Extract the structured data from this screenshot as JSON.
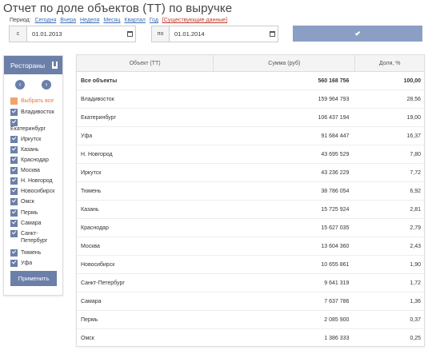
{
  "title": "Отчет по доле объектов (ТТ) по выручке",
  "period": {
    "label": "Период:",
    "links": [
      "Сегодня",
      "Вчера",
      "Неделя",
      "Месяц",
      "Квартал",
      "Год"
    ],
    "existing": "[Существующие данные]"
  },
  "date_from": {
    "prefix": "с",
    "value": "01.01.2013"
  },
  "date_to": {
    "prefix": "по",
    "value": "01.01.2014"
  },
  "sidebar": {
    "title": "Рестораны",
    "select_all": "Выбрать все",
    "items": [
      "Владивосток",
      "Екатеринбург",
      "Иркутск",
      "Казань",
      "Краснодар",
      "Москва",
      "Н. Новгород",
      "Новосибирск",
      "Омск",
      "Пермь",
      "Самара",
      "Санкт-Петербург",
      "Тюмень",
      "Уфа"
    ],
    "apply": "Применить"
  },
  "table": {
    "headers": [
      "Объект (ТТ)",
      "Сумма (руб)",
      "Доля, %"
    ],
    "total": {
      "name": "Все объекты",
      "sum": "560 168 756",
      "share": "100,00"
    },
    "rows": [
      {
        "name": "Владивосток",
        "sum": "159 964 793",
        "share": "28,56"
      },
      {
        "name": "Екатеринбург",
        "sum": "106 437 194",
        "share": "19,00"
      },
      {
        "name": "Уфа",
        "sum": "91 684 447",
        "share": "16,37"
      },
      {
        "name": "Н. Новгород",
        "sum": "43 695 529",
        "share": "7,80"
      },
      {
        "name": "Иркутск",
        "sum": "43 236 229",
        "share": "7,72"
      },
      {
        "name": "Тюмень",
        "sum": "38 786 054",
        "share": "6,92"
      },
      {
        "name": "Казань",
        "sum": "15 725 924",
        "share": "2,81"
      },
      {
        "name": "Краснодар",
        "sum": "15 627 035",
        "share": "2,79"
      },
      {
        "name": "Москва",
        "sum": "13 604 360",
        "share": "2,43"
      },
      {
        "name": "Новосибирск",
        "sum": "10 655 861",
        "share": "1,90"
      },
      {
        "name": "Санкт-Петербург",
        "sum": "9 641 319",
        "share": "1,72"
      },
      {
        "name": "Самара",
        "sum": "7 637 786",
        "share": "1,36"
      },
      {
        "name": "Пермь",
        "sum": "2 085 900",
        "share": "0,37"
      },
      {
        "name": "Омск",
        "sum": "1 386 333",
        "share": "0,25"
      }
    ]
  },
  "colors": {
    "accent": "#6b7fa9",
    "apply_top": "#8b9ec4",
    "select_all": "#e6793d"
  }
}
